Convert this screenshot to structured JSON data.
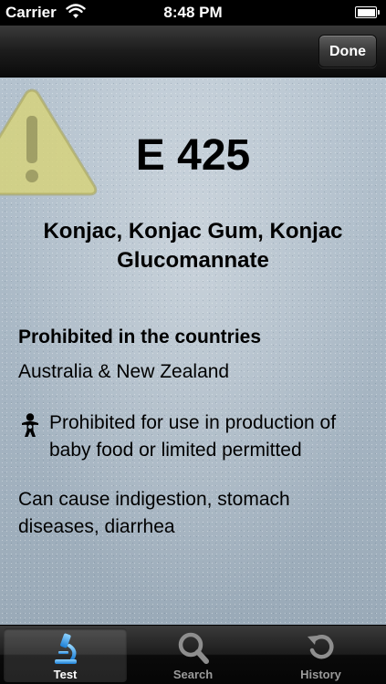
{
  "status_bar": {
    "carrier": "Carrier",
    "time": "8:48 PM",
    "icons": [
      "wifi-icon",
      "battery-icon"
    ]
  },
  "nav_bar": {
    "done_label": "Done"
  },
  "additive": {
    "code": "E 425",
    "names": "Konjac, Konjac Gum, Konjac Glucomannate",
    "prohibited_heading": "Prohibited in the countries",
    "countries": "Australia & New Zealand",
    "baby_food_note": "Prohibited for use in production of baby food or limited permitted",
    "side_effects": "Can cause indigestion, stomach diseases, diarrhea"
  },
  "tab_bar": {
    "tabs": [
      {
        "label": "Test",
        "icon": "microscope-icon",
        "selected": true
      },
      {
        "label": "Search",
        "icon": "magnifier-icon",
        "selected": false
      },
      {
        "label": "History",
        "icon": "history-icon",
        "selected": false
      }
    ]
  },
  "colors": {
    "accent_blue": "#3aa0e8",
    "warning_yellow": "#d8d27a",
    "background": "#a9b8c5"
  }
}
